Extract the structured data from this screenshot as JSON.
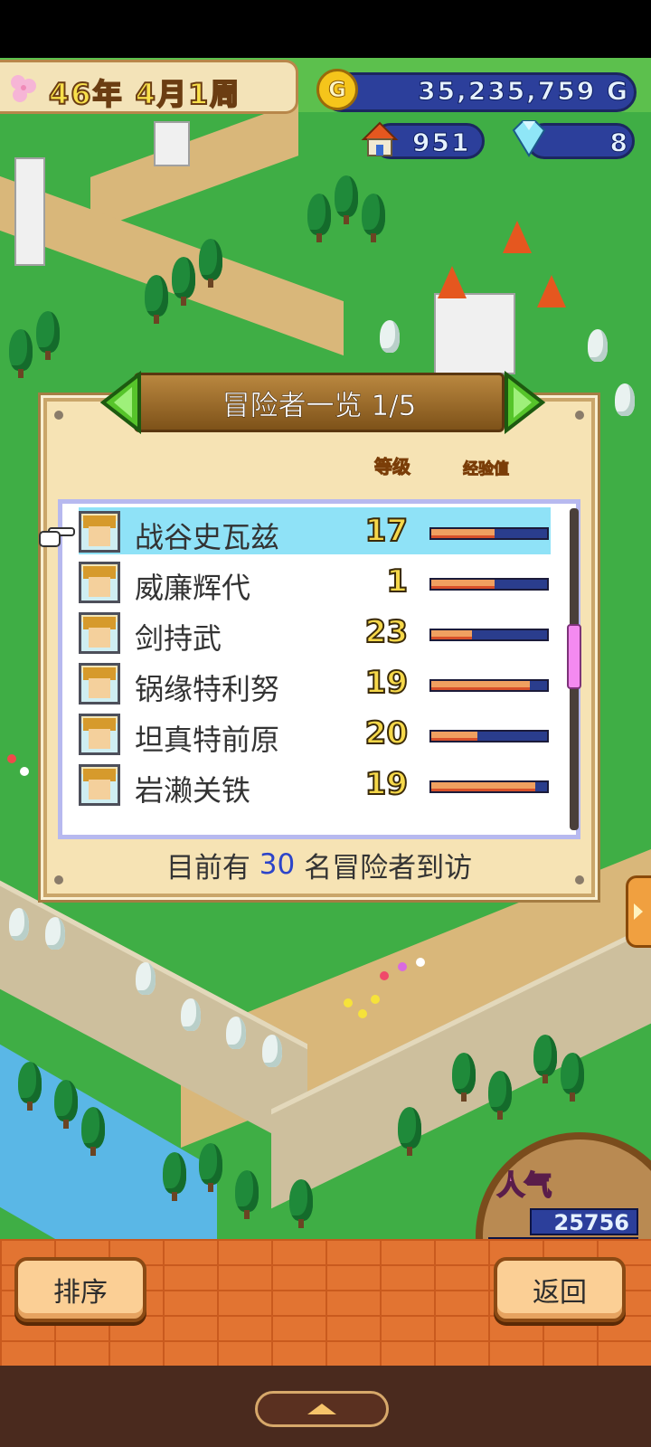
{
  "hud": {
    "date_text": "46年 4月1周",
    "gold": "35,235,759 G",
    "coin_symbol": "G",
    "population": "951",
    "gems": "8"
  },
  "panel": {
    "title": "冒险者一览 1/5",
    "col_level": "等级",
    "col_exp": "经验值",
    "visitors_prefix": "目前有",
    "visitors_count": "30",
    "visitors_suffix": "名冒险者到访"
  },
  "adventurers": [
    {
      "name": "战谷史瓦兹",
      "level": "17",
      "exp": 0.55,
      "selected": true
    },
    {
      "name": "威廉辉代",
      "level": "1",
      "exp": 0.55,
      "selected": false
    },
    {
      "name": "剑持武",
      "level": "23",
      "exp": 0.35,
      "selected": false
    },
    {
      "name": "锅缘特利努",
      "level": "19",
      "exp": 0.85,
      "selected": false
    },
    {
      "name": "坦真特前原",
      "level": "20",
      "exp": 0.4,
      "selected": false
    },
    {
      "name": "岩濑关铁",
      "level": "19",
      "exp": 0.9,
      "selected": false
    }
  ],
  "popularity": {
    "label": "人气",
    "value": "25756",
    "fill": 0.6
  },
  "buttons": {
    "sort": "排序",
    "back": "返回"
  },
  "colors": {
    "selected_row": "#8fe2f7",
    "exp_fill": "#f0a060",
    "exp_track": "#2a3d8d",
    "accent_number": "#2c44c9"
  }
}
